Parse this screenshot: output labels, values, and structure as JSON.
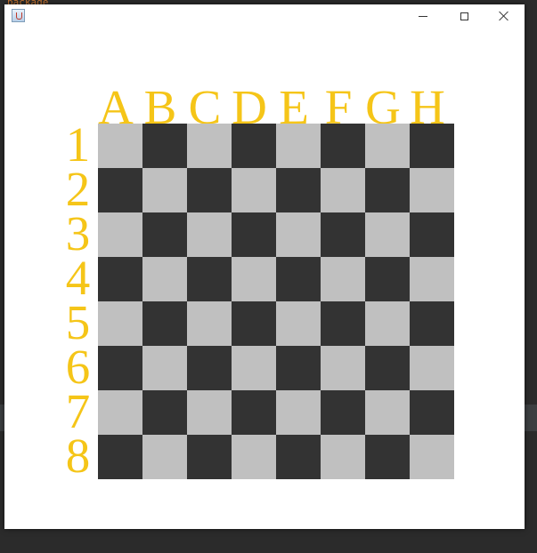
{
  "window": {
    "title": "",
    "controls": {
      "minimize": "minimize",
      "maximize": "maximize",
      "close": "close"
    }
  },
  "ide": {
    "code_line": "package GamePieces;",
    "keyword": "package"
  },
  "board": {
    "columns": [
      "A",
      "B",
      "C",
      "D",
      "E",
      "F",
      "G",
      "H"
    ],
    "rows": [
      "1",
      "2",
      "3",
      "4",
      "5",
      "6",
      "7",
      "8"
    ],
    "colors": {
      "light": "#c0c0c0",
      "dark": "#333333",
      "label": "#f5c518"
    },
    "top_left_square": "light"
  }
}
